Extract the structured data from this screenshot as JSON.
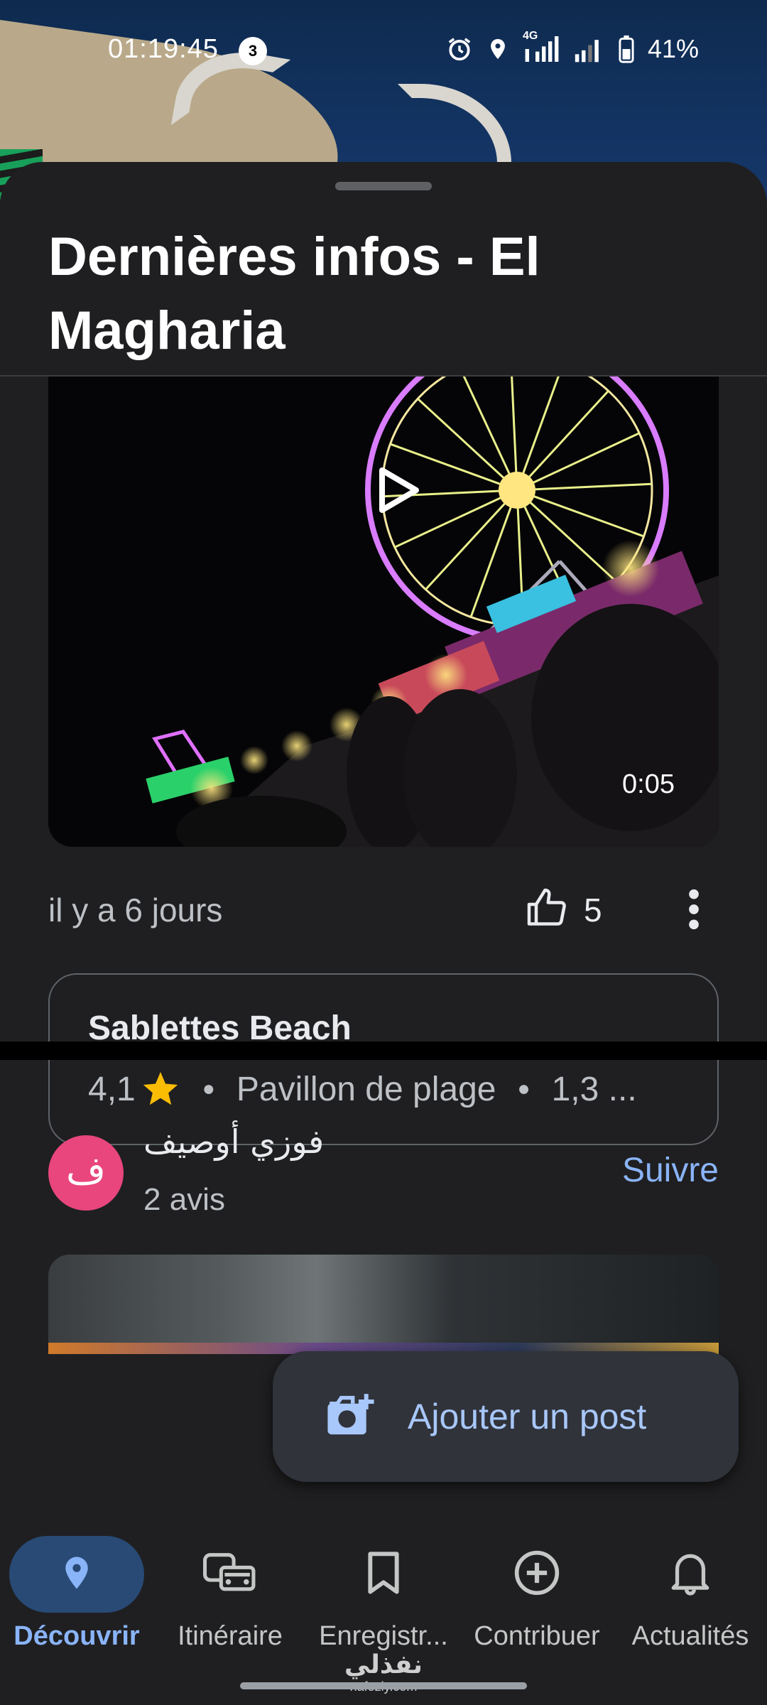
{
  "status_bar": {
    "time": "01:19:45",
    "notification_count": "3",
    "network": "4G",
    "battery": "41%"
  },
  "sheet": {
    "title": "Dernières infos - El Magharia"
  },
  "post": {
    "video_duration": "0:05",
    "time_ago": "il y a 6 jours",
    "likes": "5"
  },
  "place": {
    "name": "Sablettes Beach",
    "rating": "4,1",
    "category": "Pavillon de plage",
    "distance": "1,3 ..."
  },
  "next_post": {
    "avatar_letter": "ف",
    "author": "فوزي أوصيف",
    "reviews": "2 avis",
    "follow_label": "Suivre"
  },
  "fab": {
    "label": "Ajouter un post",
    "icon": "add-photo-icon"
  },
  "nav": {
    "items": [
      {
        "label": "Découvrir",
        "icon": "location-pin-icon",
        "active": true
      },
      {
        "label": "Itinéraire",
        "icon": "commute-icon",
        "active": false
      },
      {
        "label": "Enregistr...",
        "icon": "bookmark-icon",
        "active": false
      },
      {
        "label": "Contribuer",
        "icon": "add-circle-icon",
        "active": false
      },
      {
        "label": "Actualités",
        "icon": "bell-icon",
        "active": false
      }
    ]
  },
  "watermark": {
    "arabic": "نفذلي",
    "latin": "nafezly.com"
  },
  "colors": {
    "accent": "#8ab4f8",
    "avatar": "#e8467c",
    "sheet_bg": "#1f1f21",
    "star": "#fbbc04"
  }
}
